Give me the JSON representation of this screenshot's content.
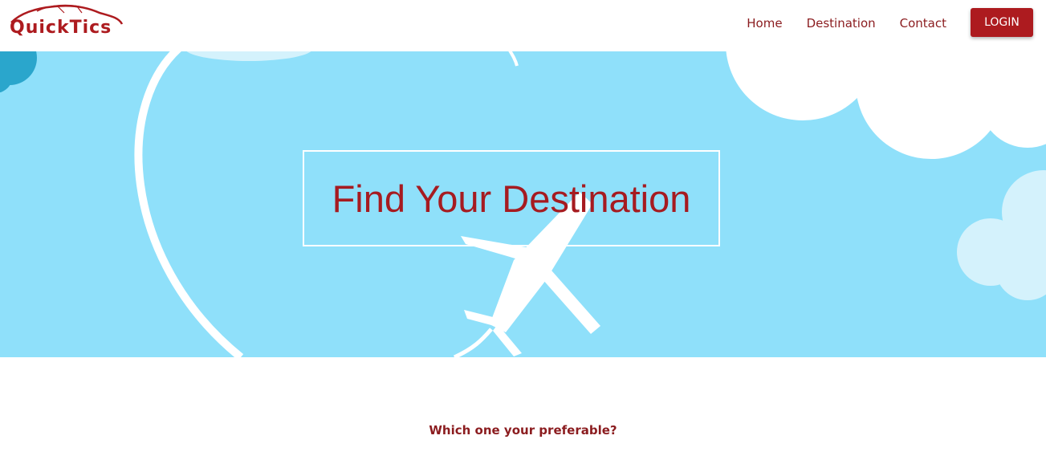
{
  "brand": {
    "name": "QuickTics",
    "color": "#ad1b1f"
  },
  "nav": {
    "links": [
      {
        "label": "Home"
      },
      {
        "label": "Destination"
      },
      {
        "label": "Contact"
      }
    ],
    "login_label": "LOGIN"
  },
  "hero": {
    "title": "Find Your Destination",
    "background_color": "#8fe0fa",
    "illustration": [
      "airplane-icon",
      "cloud-icon",
      "flight-path"
    ]
  },
  "main": {
    "question": "Which one your preferable?"
  }
}
